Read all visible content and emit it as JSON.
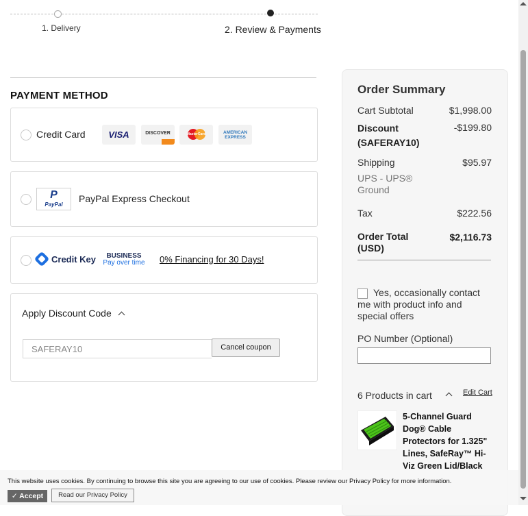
{
  "steps": {
    "step1": "1. Delivery",
    "step2": "2. Review & Payments"
  },
  "payment": {
    "title": "PAYMENT METHOD",
    "credit_card_label": "Credit Card",
    "card_logos": {
      "visa": "VISA",
      "discover": "DISCOVER",
      "mastercard": "MasterCard",
      "amex_line1": "AMERICAN",
      "amex_line2": "EXPRESS"
    },
    "paypal_logo": "PayPal",
    "paypal_label": "PayPal Express Checkout",
    "creditkey_logo": "Credit Key",
    "creditkey_business": "BUSINESS",
    "creditkey_payover": "Pay over time",
    "creditkey_financing": "0% Financing for 30 Days!"
  },
  "discount": {
    "title": "Apply Discount Code",
    "code_value": "SAFERAY10",
    "cancel_label": "Cancel coupon"
  },
  "summary": {
    "title": "Order Summary",
    "cart_subtotal_label": "Cart Subtotal",
    "cart_subtotal_value": "$1,998.00",
    "discount_label": "Discount (SAFERAY10)",
    "discount_value": "-$199.80",
    "shipping_label": "Shipping",
    "shipping_value": "$95.97",
    "shipping_method": "UPS - UPS® Ground",
    "tax_label": "Tax",
    "tax_value": "$222.56",
    "total_label": "Order Total (USD)",
    "total_value": "$2,116.73",
    "contact_label": "Yes, occasionally contact me with product info and special offers",
    "po_label": "PO Number (Optional)",
    "products_in_cart": "6 Products in cart",
    "edit_cart": "Edit Cart",
    "product_name": "5-Channel Guard Dog® Cable Protectors for 1.325\" Lines, SafeRay™ Hi-Viz Green Lid/Black"
  },
  "cookie": {
    "text": "This website uses cookies. By continuing to browse this site you are agreeing to our use of cookies. Please review our Privacy Policy for more information.",
    "accept": "Accept",
    "privacy": "Read our Privacy Policy"
  },
  "colors": {
    "accent_blue": "#1d6fe0",
    "summary_bg": "#f6f6f6"
  }
}
